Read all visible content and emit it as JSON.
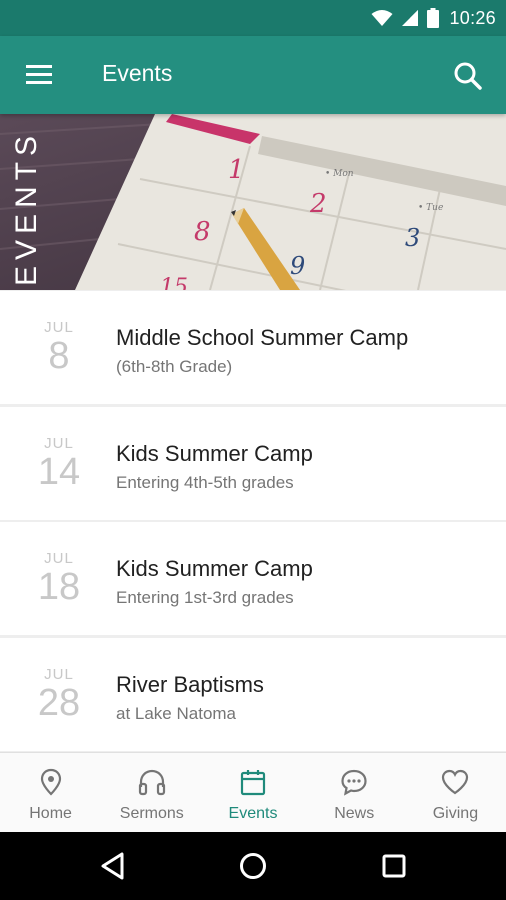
{
  "status_bar": {
    "time": "10:26",
    "icons": [
      "wifi-icon",
      "signal-icon",
      "battery-icon"
    ]
  },
  "app_bar": {
    "title": "Events",
    "left_icon": "menu-icon",
    "right_icon": "search-icon",
    "color": "#248f80"
  },
  "banner": {
    "label": "EVENTS",
    "calendar_numbers": [
      "1",
      "2",
      "3",
      "8",
      "9",
      "15"
    ],
    "calendar_day_tabs": [
      "Mon",
      "Tue"
    ]
  },
  "events": [
    {
      "month": "JUL",
      "day": "8",
      "title": "Middle School Summer Camp",
      "subtitle": "(6th-8th Grade)"
    },
    {
      "month": "JUL",
      "day": "14",
      "title": "Kids Summer Camp",
      "subtitle": "Entering 4th-5th grades"
    },
    {
      "month": "JUL",
      "day": "18",
      "title": "Kids Summer Camp",
      "subtitle": "Entering 1st-3rd grades"
    },
    {
      "month": "JUL",
      "day": "28",
      "title": "River Baptisms",
      "subtitle": "at Lake Natoma"
    }
  ],
  "bottom_nav": {
    "items": [
      {
        "label": "Home",
        "icon": "location-pin-icon"
      },
      {
        "label": "Sermons",
        "icon": "headphones-icon"
      },
      {
        "label": "Events",
        "icon": "calendar-icon"
      },
      {
        "label": "News",
        "icon": "chat-bubble-icon"
      },
      {
        "label": "Giving",
        "icon": "heart-icon"
      }
    ],
    "active": "Events",
    "active_color": "#1f8a7b"
  },
  "system_nav": {
    "icons": [
      "back-icon",
      "home-circle-icon",
      "recents-icon"
    ]
  }
}
